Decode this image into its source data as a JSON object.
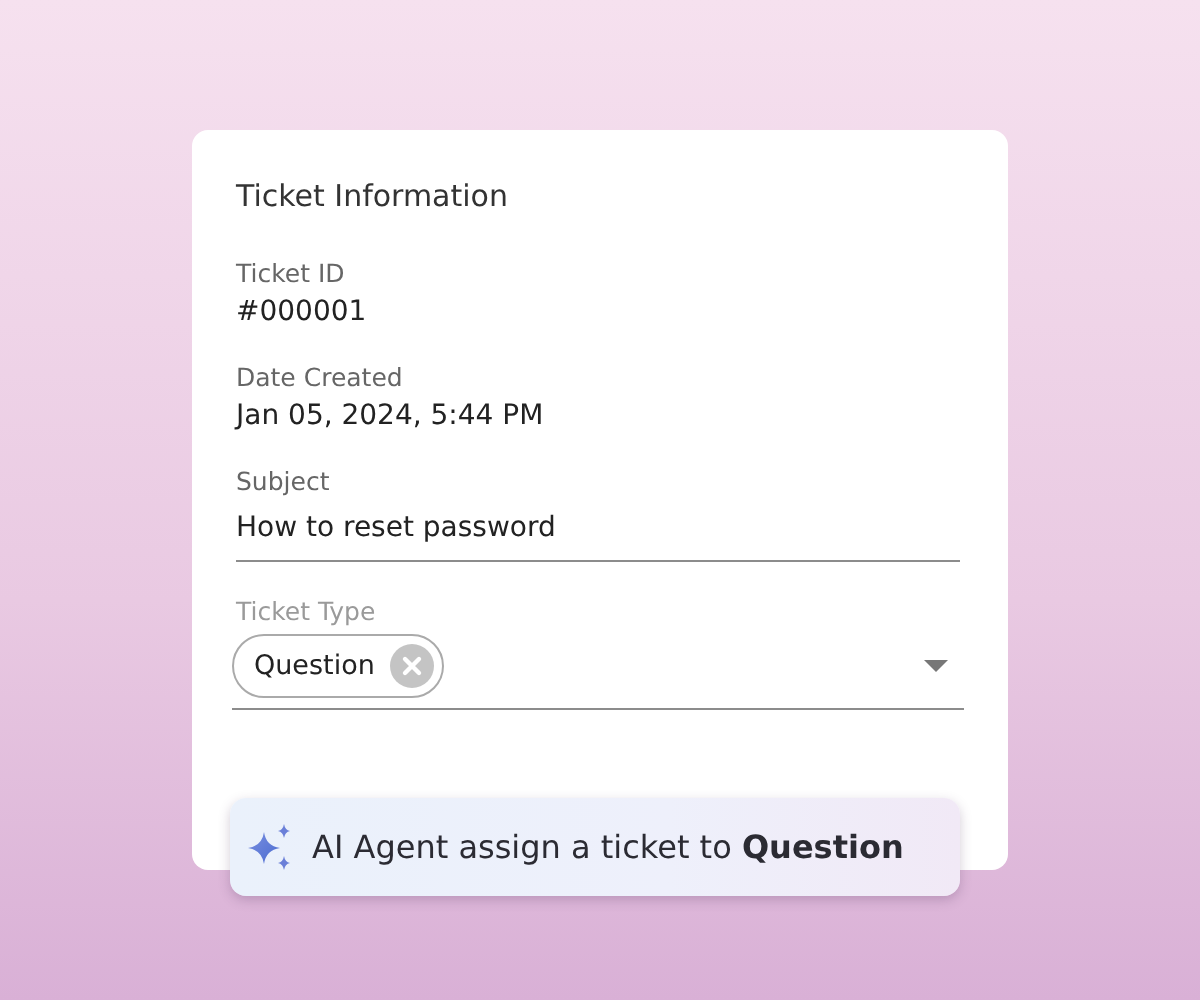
{
  "card": {
    "title": "Ticket Information",
    "fields": [
      {
        "kind": "text",
        "label": "Ticket ID",
        "value": "#000001"
      },
      {
        "kind": "text",
        "label": "Date Created",
        "value": "Jan 05, 2024, 5:44 PM"
      },
      {
        "kind": "input",
        "label": "Subject",
        "value": "How to reset password"
      },
      {
        "kind": "select",
        "label": "Ticket Type",
        "chips": [
          "Question"
        ]
      }
    ]
  },
  "toast": {
    "text": "AI Agent assign a ticket to **Question**"
  }
}
